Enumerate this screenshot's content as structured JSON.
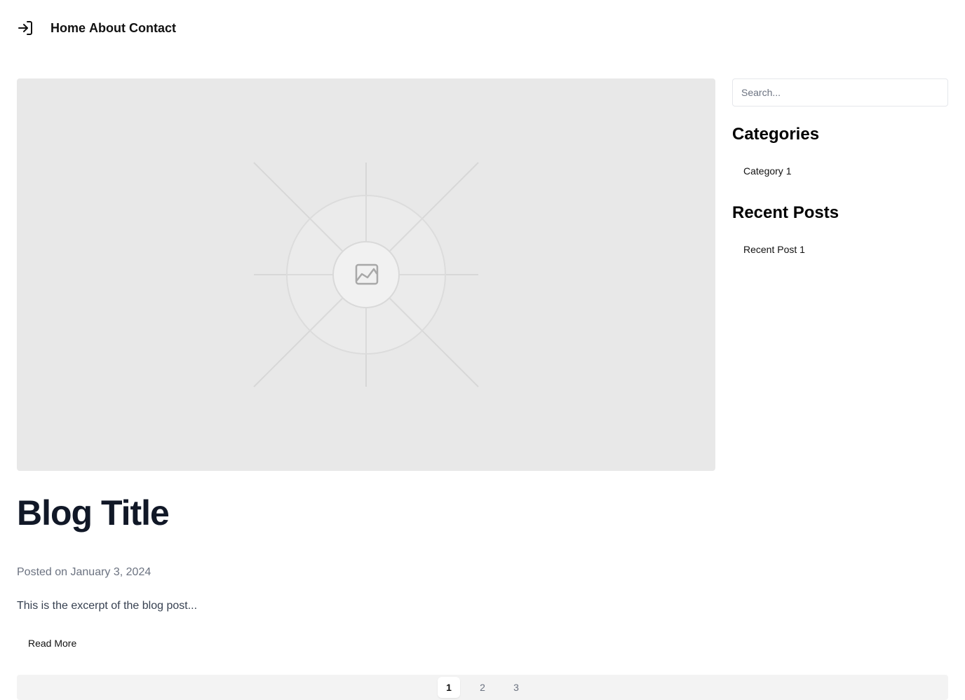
{
  "header": {
    "login_icon": "login-arrow-icon",
    "nav": [
      {
        "label": "Home"
      },
      {
        "label": "About"
      },
      {
        "label": "Contact"
      }
    ]
  },
  "post": {
    "image_icon": "image-placeholder-icon",
    "title": "Blog Title",
    "meta": "Posted on January 3, 2024",
    "excerpt": "This is the excerpt of the blog post...",
    "read_more_label": "Read More"
  },
  "pagination": {
    "pages": [
      "1",
      "2",
      "3"
    ],
    "active_page": "1"
  },
  "sidebar": {
    "search": {
      "placeholder": "Search...",
      "value": ""
    },
    "categories_heading": "Categories",
    "categories": [
      {
        "label": "Category 1"
      }
    ],
    "recent_heading": "Recent Posts",
    "recent_posts": [
      {
        "label": "Recent Post 1"
      }
    ]
  },
  "colors": {
    "placeholder_bg": "#e8e8e8",
    "pagination_bg": "#f3f3f3",
    "muted_text": "#6b7280"
  }
}
